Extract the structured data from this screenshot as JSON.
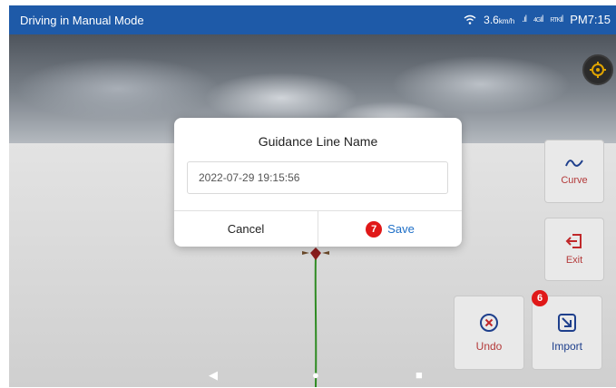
{
  "statusbar": {
    "title": "Driving in Manual Mode",
    "speed": "3.6",
    "speed_unit": "km/h",
    "signal_4g_label": "4G",
    "signal_rtk_label": "RTK",
    "clock": "PM7:15"
  },
  "map": {
    "locate_icon": "crosshair-icon",
    "guide_color": "#2e8b22"
  },
  "tools": {
    "curve_label": "Curve",
    "exit_label": "Exit",
    "undo_label": "Undo",
    "import_label": "Import",
    "import_badge": "6"
  },
  "dialog": {
    "title": "Guidance Line Name",
    "input_value": "2022-07-29 19:15:56",
    "cancel_label": "Cancel",
    "save_label": "Save",
    "save_badge": "7"
  },
  "navbar": {
    "back": "◀",
    "home": "●",
    "recent": "■"
  },
  "colors": {
    "statusbar": "#1e5aa8",
    "accent_red": "#b43a3a",
    "save_blue": "#1e6fc7",
    "badge_red": "#e01818"
  }
}
